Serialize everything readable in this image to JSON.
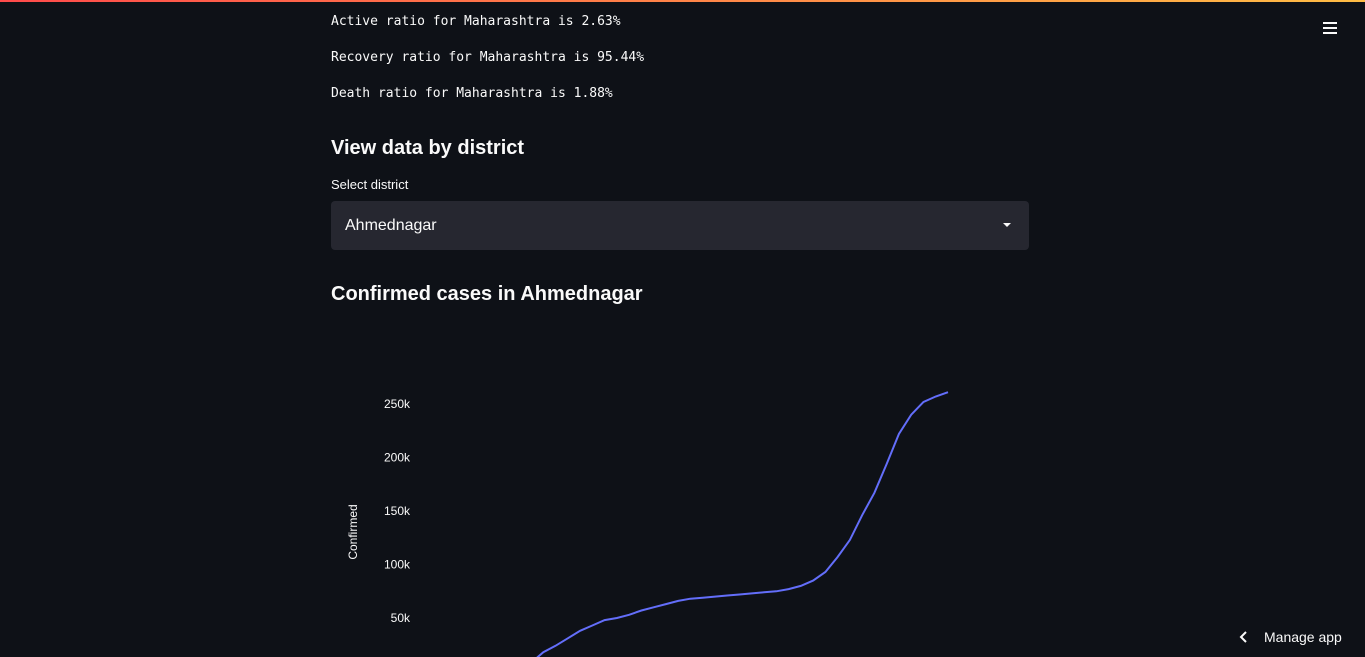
{
  "stats": {
    "active": "Active ratio for Maharashtra is 2.63%",
    "recovery": "Recovery ratio for Maharashtra is 95.44%",
    "death": "Death ratio for Maharashtra is 1.88%"
  },
  "district_section": {
    "heading": "View data by district",
    "select_label": "Select district",
    "select_value": "Ahmednagar"
  },
  "chart_heading": "Confirmed cases in Ahmednagar",
  "manage_app": "Manage app",
  "colors": {
    "line": "#636efa",
    "background": "#0e1117",
    "select_bg": "#262730"
  },
  "icons": {
    "menu": "hamburger-menu-icon",
    "manage": "chevron-left-icon",
    "select": "caret-down-icon"
  },
  "chart_data": {
    "type": "line",
    "title": "",
    "xlabel": "",
    "ylabel": "Confirmed",
    "y_ticks": [
      "50k",
      "100k",
      "150k",
      "200k",
      "250k"
    ],
    "y_tick_values": [
      50000,
      100000,
      150000,
      200000,
      250000
    ],
    "grid": false,
    "series": [
      {
        "name": "",
        "values": [
          8000,
          18000,
          24000,
          31000,
          38000,
          43000,
          48000,
          50000,
          53000,
          57000,
          60000,
          63000,
          66000,
          68000,
          69000,
          70000,
          71000,
          72000,
          73000,
          74000,
          75000,
          77000,
          80000,
          85000,
          93000,
          107000,
          123000,
          146000,
          167000,
          194000,
          222000,
          240000,
          252000,
          257000,
          261000
        ]
      }
    ]
  }
}
